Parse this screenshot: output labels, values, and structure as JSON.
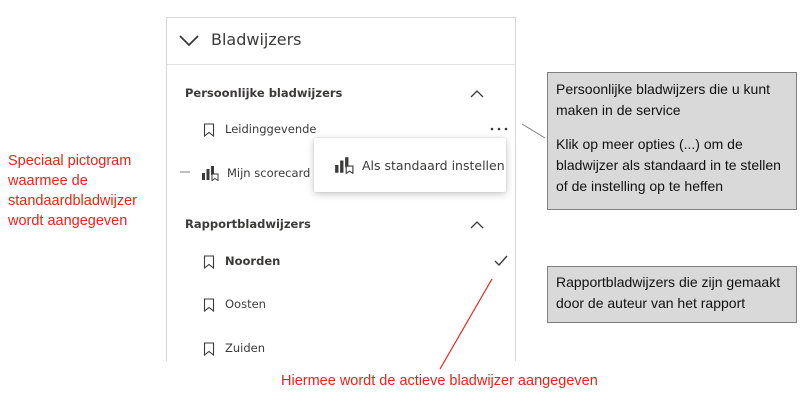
{
  "pane": {
    "title": "Bladwijzers",
    "personal": {
      "title": "Persoonlijke bladwijzers",
      "items": [
        {
          "label": "Leidinggevende"
        },
        {
          "label": "Mijn scorecard"
        }
      ]
    },
    "report": {
      "title": "Rapportbladwijzers",
      "items": [
        {
          "label": "Noorden",
          "active": true
        },
        {
          "label": "Oosten"
        },
        {
          "label": "Zuiden"
        }
      ]
    }
  },
  "context_menu": {
    "set_default_label": "Als standaard instellen"
  },
  "callouts": {
    "personal_line1": "Persoonlijke bladwijzers die u kunt maken in de service",
    "personal_line2": "Klik op meer opties (...) om de bladwijzer als standaard in te stellen of de instelling op te heffen",
    "report": "Rapportbladwijzers die zijn gemaakt door de auteur van het rapport"
  },
  "annotations": {
    "special_icon": "Speciaal pictogram waarmee de standaardbladwijzer wordt aangegeven",
    "active": "Hiermee wordt de actieve bladwijzer aangegeven"
  },
  "icons": {
    "collapse": "chevron-down-icon",
    "section_toggle": "chevron-up-icon",
    "bookmark": "bookmark-icon",
    "default_bookmark": "default-bookmark-icon",
    "more": "more-options-icon",
    "active": "checkmark-icon"
  },
  "colors": {
    "annotation_red": "#e8231a",
    "callout_bg": "#d9d9d9",
    "text": "#3b3a39"
  }
}
